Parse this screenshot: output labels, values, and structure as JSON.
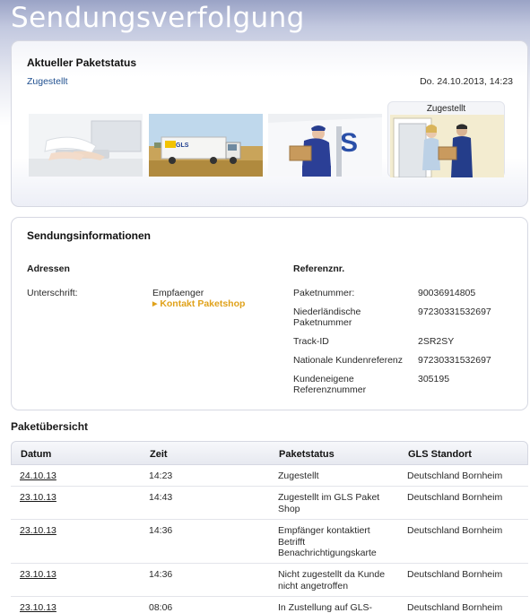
{
  "header": {
    "title": "Sendungsverfolgung"
  },
  "status_panel": {
    "title": "Aktueller Paketstatus",
    "status": "Zugestellt",
    "datetime": "Do. 24.10.2013, 14:23",
    "active_step_label": "Zugestellt"
  },
  "info_panel": {
    "title": "Sendungsinformationen",
    "addresses": {
      "heading": "Adressen",
      "signature_label": "Unterschrift:",
      "signature_value": "Empfaenger",
      "shop_link": "Kontakt Paketshop"
    },
    "references": {
      "heading": "Referenznr.",
      "rows": [
        {
          "label": "Paketnummer:",
          "value": "90036914805"
        },
        {
          "label": "Niederländische Paketnummer",
          "value": "97230331532697"
        },
        {
          "label": "Track-ID",
          "value": "2SR2SY"
        },
        {
          "label": "Nationale Kundenreferenz",
          "value": "97230331532697"
        },
        {
          "label": "Kundeneigene Referenznummer",
          "value": "305195"
        }
      ]
    }
  },
  "overview": {
    "title": "Paketübersicht",
    "columns": [
      "Datum",
      "Zeit",
      "Paketstatus",
      "GLS Standort"
    ],
    "rows": [
      {
        "date": "24.10.13",
        "time": "14:23",
        "status": "Zugestellt",
        "location": "Deutschland Bornheim"
      },
      {
        "date": "23.10.13",
        "time": "14:43",
        "status": "Zugestellt im GLS Paket Shop",
        "location": "Deutschland Bornheim"
      },
      {
        "date": "23.10.13",
        "time": "14:36",
        "status": "Empfänger kontaktiert Betrifft Benachrichtigungskarte",
        "location": "Deutschland Bornheim"
      },
      {
        "date": "23.10.13",
        "time": "14:36",
        "status": "Nicht zugestellt da Kunde nicht angetroffen",
        "location": "Deutschland Bornheim"
      },
      {
        "date": "23.10.13",
        "time": "08:06",
        "status": "In Zustellung auf GLS-",
        "location": "Deutschland Bornheim"
      }
    ]
  },
  "colors": {
    "brand_blue": "#1f4f8f",
    "link_orange": "#e0a21b",
    "header_gradient_top": "#9aa3c6"
  }
}
